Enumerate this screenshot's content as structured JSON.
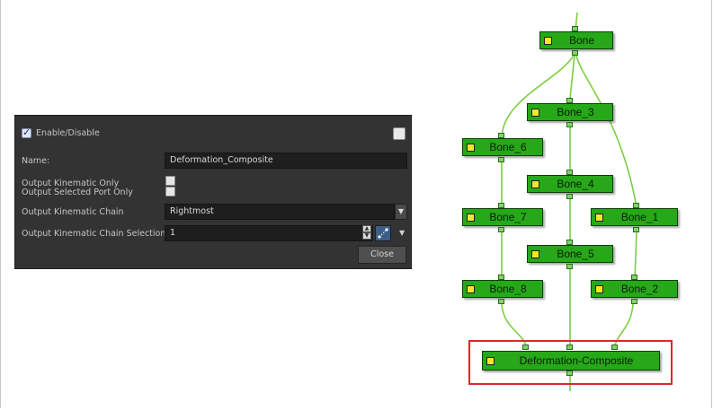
{
  "dialog": {
    "enable_label": "Enable/Disable",
    "enable_checked": true,
    "name_label": "Name:",
    "name_value": "Deformation_Composite",
    "kinematic_only_label": "Output Kinematic Only",
    "selected_port_label": "Output Selected Port Only",
    "chain_label": "Output Kinematic Chain",
    "chain_value": "Rightmost",
    "chain_selection_label": "Output Kinematic Chain Selection",
    "chain_selection_value": "1",
    "close_label": "Close"
  },
  "graph": {
    "nodes": {
      "bone": "Bone",
      "bone_3": "Bone_3",
      "bone_6": "Bone_6",
      "bone_4": "Bone_4",
      "bone_7": "Bone_7",
      "bone_1": "Bone_1",
      "bone_5": "Bone_5",
      "bone_8": "Bone_8",
      "bone_2": "Bone_2",
      "composite": "Deformation-Composite"
    },
    "highlighted_node": "Deformation-Composite",
    "colors": {
      "node_fill": "#26a818",
      "node_icon": "#f3e72a",
      "connection": "#7ccf40",
      "highlight": "#e0262b"
    }
  }
}
